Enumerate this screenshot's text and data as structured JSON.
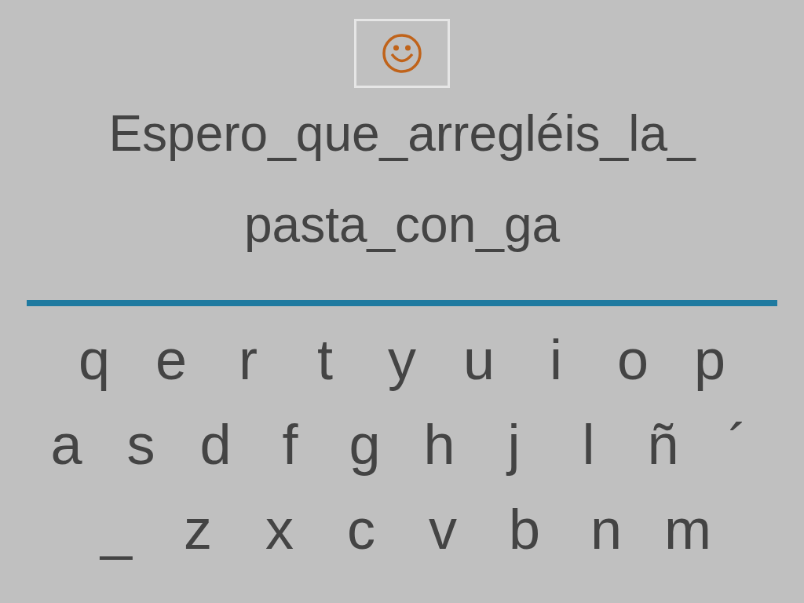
{
  "phrase_lines": [
    "Espero_que_arregléis_la_",
    "pasta_con_ga"
  ],
  "keyboard_rows": [
    [
      "q",
      "e",
      "r",
      "t",
      "y",
      "u",
      "i",
      "o",
      "p"
    ],
    [
      "a",
      "s",
      "d",
      "f",
      "g",
      "h",
      "j",
      "l",
      "ñ",
      "´"
    ],
    [
      "_",
      "z",
      "x",
      "c",
      "v",
      "b",
      "n",
      "m"
    ]
  ]
}
